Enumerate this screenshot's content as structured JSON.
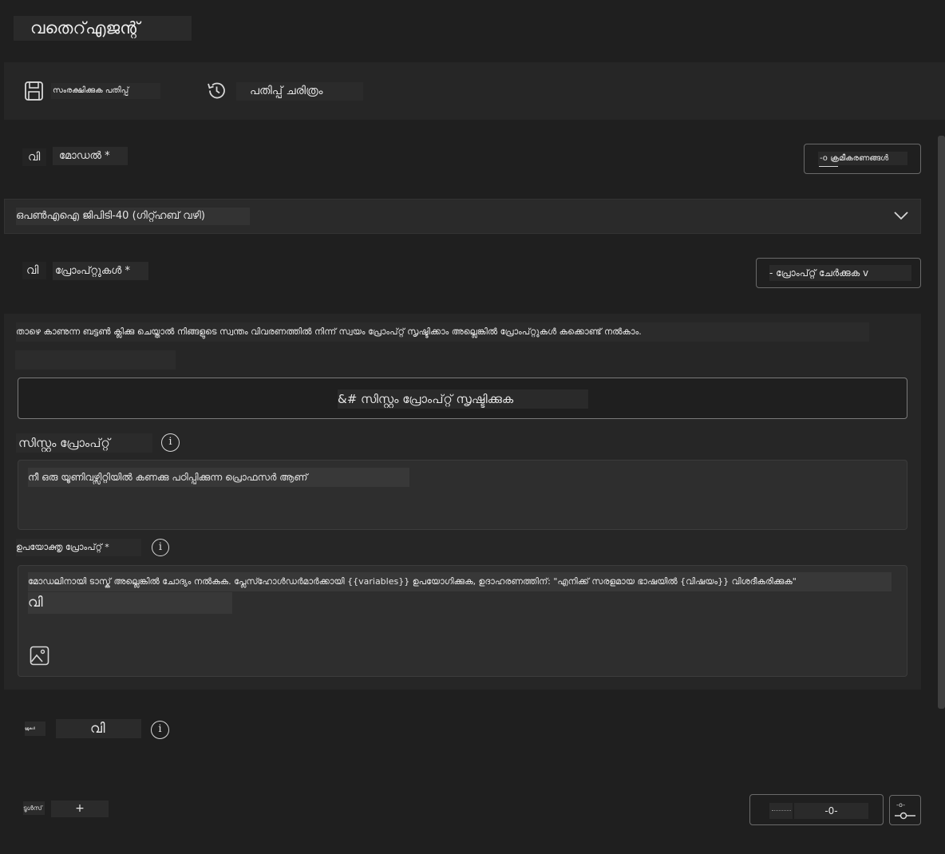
{
  "header": {
    "title": "വതെറ്എജന്റ്"
  },
  "toolbar": {
    "save_label": "സംരക്ഷിക്കുക പതിപ്പ്",
    "history_label": "പതിപ്പ് ചരിത്രം",
    "save_icon": "save-icon",
    "history_icon": "history-icon"
  },
  "model": {
    "prefix": "വി",
    "label": "മോഡൽ *",
    "settings_button": "-o ക്രമീകരണങ്ങൾ",
    "selected": "ഒപൺഎഐ ജിപിടി-40 (ഗിറ്റ്ഹബ് വഴി)"
  },
  "prompts": {
    "prefix": "വി",
    "label": "പ്രോംപ്റ്റുകൾ *",
    "add_button": "- പ്രോംപ്റ്റ് ചേർക്കുക v",
    "description": "താഴെ കാണുന്ന ബട്ടൺ ക്ലിക്കു ചെയ്താൽ നിങ്ങളുടെ സ്വന്തം വിവരണത്തിൽ നിന്ന് സ്വയം പ്രോംപ്റ്റ് സൃഷ്ടിക്കാം അല്ലെങ്കിൽ പ്രോംപ്റ്റുകൾ കക്കൊണ്ട് നൽകാം.",
    "generate_button": "&# സിസ്റ്റം പ്രോംപ്റ്റ് സൃഷ്ടിക്കുക",
    "system_label": "സിസ്റ്റം പ്രോംപ്റ്റ്",
    "system_value": "നീ ഒരു യൂണിവഴ്സിറ്റിയിൽ കണക്കു പഠിപ്പിക്കുന്ന പ്രൊഫസർ ആണ്",
    "user_label": "ഉപയോക്തൃ പ്രോംപ്റ്റ് *",
    "user_placeholder": "മോഡലിനായി ടാസ്ക് അല്ലെങ്കിൽ ചോദ്യം നൽകുക. പ്ലേസ്ഹോൾഡർമാർക്കായി {{variables}} ഉപയോഗിക്കുക, ഉദാഹരണത്തിന്: \"എനിക്ക് സരളമായ ഭാഷയിൽ {വിഷയം}} വിശദീകരിക്കുക\"",
    "user_suffix": "വി"
  },
  "bottom": {
    "tiny_label": "ടൂളുകൾ",
    "v_label": "വി",
    "tools_label": "ടൂൾസ്",
    "add_symbol": "+",
    "counter_value": "-0-",
    "slider_icon": "settings-slider-icon"
  }
}
